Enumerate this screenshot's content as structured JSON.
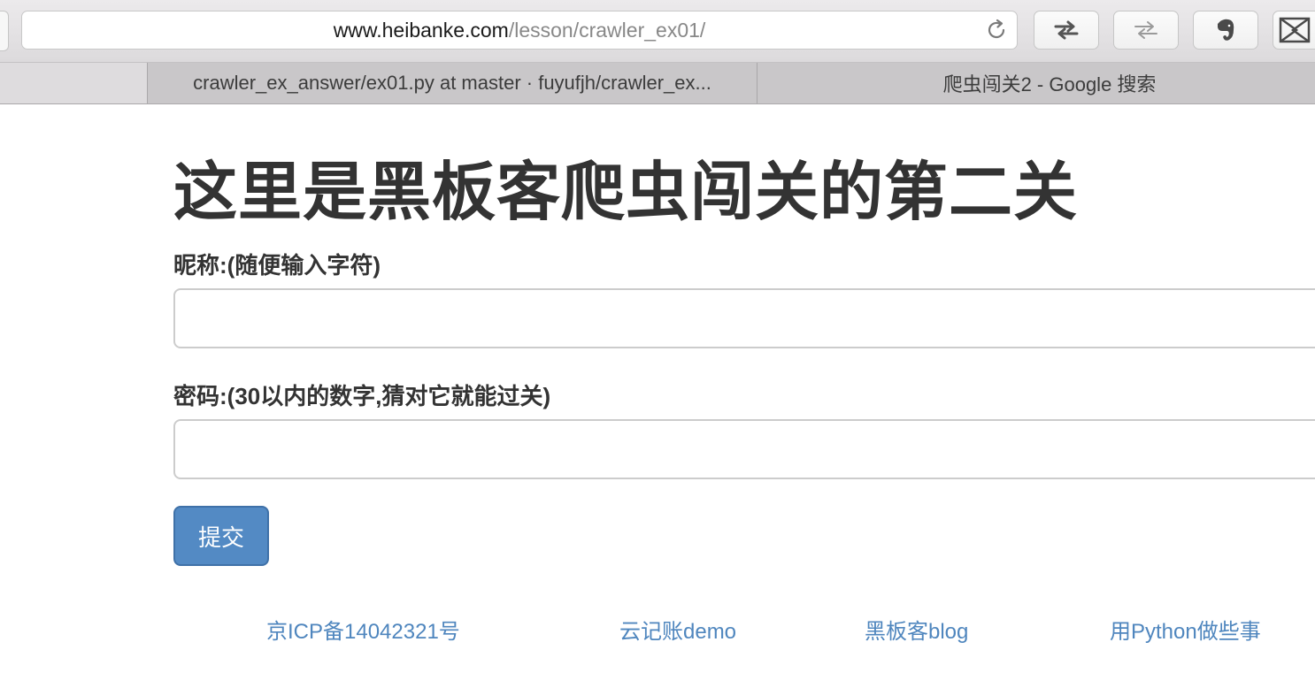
{
  "browser": {
    "url_host": "www.heibanke.com",
    "url_path": "/lesson/crawler_ex01/",
    "tabs": [
      {
        "label": ""
      },
      {
        "label": "crawler_ex_answer/ex01.py at master · fuyufjh/crawler_ex..."
      },
      {
        "label": "爬虫闯关2 - Google 搜索"
      }
    ],
    "icons": {
      "reload": "reload-icon",
      "swap_active": "swap-arrows-icon",
      "swap_inactive": "swap-arrows-icon",
      "evernote": "evernote-elephant-icon",
      "extension": "extension-icon"
    }
  },
  "page": {
    "title": "这里是黑板客爬虫闯关的第二关",
    "form": {
      "nickname_label": "昵称:(随便输入字符)",
      "nickname_value": "",
      "password_label": "密码:(30以内的数字,猜对它就能过关)",
      "password_value": "",
      "submit_label": "提交"
    },
    "footer_links": [
      "京ICP备14042321号",
      "云记账demo",
      "黑板客blog",
      "用Python做些事"
    ]
  },
  "colors": {
    "primary_button": "#538ac4",
    "link": "#4f86be",
    "text": "#333333"
  }
}
